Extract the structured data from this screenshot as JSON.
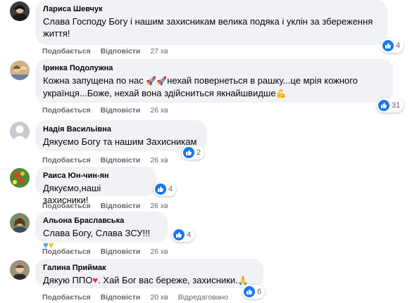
{
  "actions": {
    "like": "Подобається",
    "reply": "Відповісти"
  },
  "comments": [
    {
      "author": "Лариса Шевчук",
      "text": "Слава Господу Богу і нашим захисникам велика подяка і уклін за збереження життя!",
      "time": "27 хв",
      "reactions": "4"
    },
    {
      "author": "Іринка Подолужна",
      "text_a": "Кожна запущена по нас",
      "text_b": "нехай повернеться в рашку...це мрія кожного українця...Боже, нехай вона здійсниться якнайшвидше",
      "time": "26 хв",
      "reactions": "31"
    },
    {
      "author": "Надія Васильівна",
      "text": "Дякуємо Богу та нашим Захисникам",
      "time": "26 хв",
      "reactions": "2"
    },
    {
      "author": "Раиса Юн-чин-ян",
      "text": "Дякуємо,наші захисники!",
      "time": "26 хв",
      "reactions": "4"
    },
    {
      "author": "Альона Браславська",
      "text": "Слава Богу, Слава ЗСУ!!!",
      "time": "26 хв",
      "reactions": "4"
    },
    {
      "author": "Галина Приймак",
      "text_a": "Дякую ППО",
      "text_b": ". Хай Бог вас береже, захисники.",
      "time": "20 хв",
      "edited": "Відредаговано",
      "reactions": "6"
    }
  ],
  "colors": {
    "like_blue": "#1877f2",
    "bubble_bg": "#f0f2f5",
    "meta_gray": "#65676b"
  }
}
